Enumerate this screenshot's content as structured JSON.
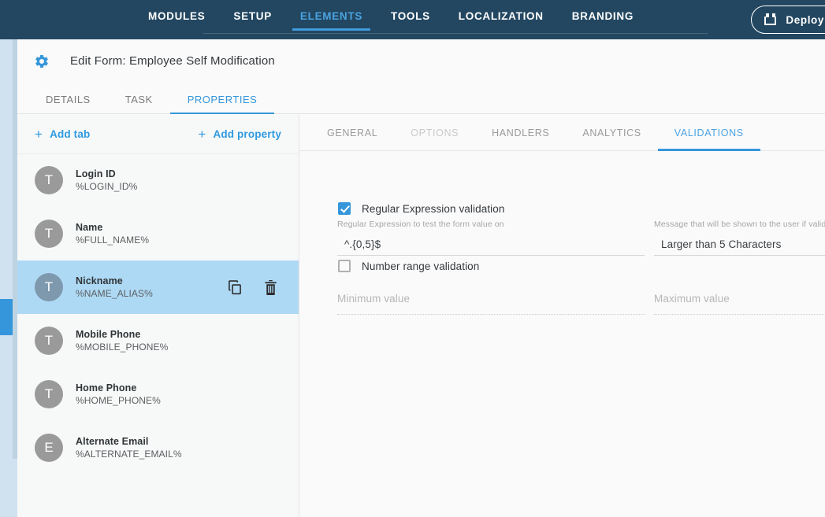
{
  "topnav": {
    "items": [
      {
        "label": "MODULES",
        "active": false
      },
      {
        "label": "SETUP",
        "active": false
      },
      {
        "label": "ELEMENTS",
        "active": true
      },
      {
        "label": "TOOLS",
        "active": false
      },
      {
        "label": "LOCALIZATION",
        "active": false
      },
      {
        "label": "BRANDING",
        "active": false
      }
    ],
    "deploy_label": "Deploy",
    "accent": "#3f9bdc",
    "background": "#234761"
  },
  "card": {
    "title": "Edit Form: Employee Self Modification",
    "gear_icon": "gear-icon"
  },
  "subtabs": [
    {
      "label": "DETAILS",
      "active": false
    },
    {
      "label": "TASK",
      "active": false
    },
    {
      "label": "PROPERTIES",
      "active": true
    }
  ],
  "left_panel": {
    "add_tab_label": "Add tab",
    "add_property_label": "Add property",
    "plus": "+",
    "items": [
      {
        "avatar": "T",
        "label": "Login ID",
        "token": "%LOGIN_ID%",
        "selected": false
      },
      {
        "avatar": "T",
        "label": "Name",
        "token": "%FULL_NAME%",
        "selected": false
      },
      {
        "avatar": "T",
        "label": "Nickname",
        "token": "%NAME_ALIAS%",
        "selected": true
      },
      {
        "avatar": "T",
        "label": "Mobile Phone",
        "token": "%MOBILE_PHONE%",
        "selected": false
      },
      {
        "avatar": "T",
        "label": "Home Phone",
        "token": "%HOME_PHONE%",
        "selected": false
      },
      {
        "avatar": "E",
        "label": "Alternate Email",
        "token": "%ALTERNATE_EMAIL%",
        "selected": false
      }
    ],
    "selected_row_actions": {
      "duplicate_icon": "copy-icon",
      "delete_icon": "trash-icon"
    },
    "selected_highlight_color": "#aed9f4"
  },
  "right_panel": {
    "tabs": [
      {
        "label": "GENERAL",
        "state": "normal"
      },
      {
        "label": "OPTIONS",
        "state": "disabled"
      },
      {
        "label": "HANDLERS",
        "state": "normal"
      },
      {
        "label": "ANALYTICS",
        "state": "normal"
      },
      {
        "label": "VALIDATIONS",
        "state": "active"
      }
    ],
    "regex_validation": {
      "checkbox_label": "Regular Expression validation",
      "checked": true,
      "pattern_hint": "Regular Expression to test the form value on",
      "pattern_value": "^.{0,5}$",
      "message_hint": "Message that will be shown to the user if validation fails",
      "message_value": "Larger than 5 Characters"
    },
    "number_range_validation": {
      "checkbox_label": "Number range validation",
      "checked": false,
      "minimum_placeholder": "Minimum value",
      "maximum_placeholder": "Maximum value"
    }
  }
}
